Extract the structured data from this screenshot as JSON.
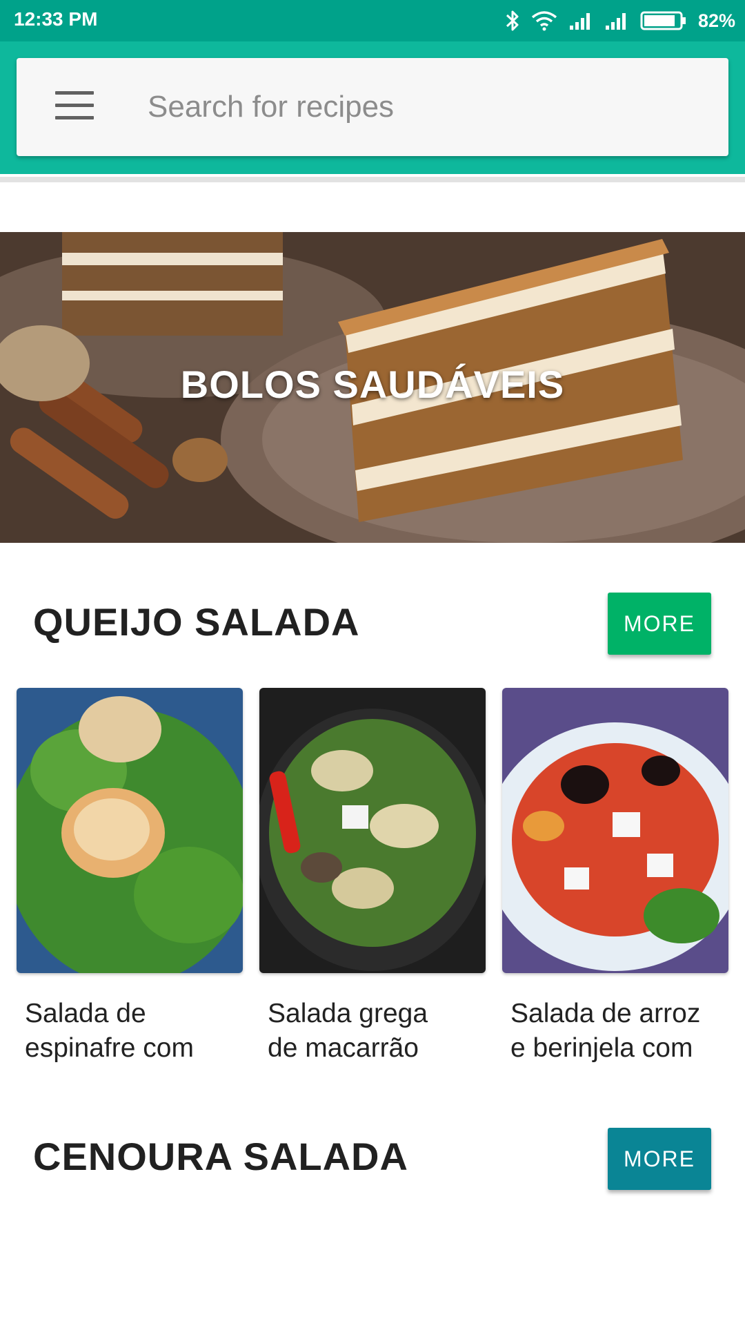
{
  "status_bar": {
    "time": "12:33 PM",
    "battery": "82%"
  },
  "search": {
    "placeholder": "Search for recipes"
  },
  "hero": {
    "title": "BOLOS SAUDÁVEIS"
  },
  "sections": [
    {
      "title": "QUEIJO SALADA",
      "more_label": "MORE",
      "more_color": "#00b267",
      "items": [
        {
          "title_line1": "Salada de",
          "title_line2": "espinafre com"
        },
        {
          "title_line1": "Salada grega",
          "title_line2": "de macarrão"
        },
        {
          "title_line1": "Salada de arroz",
          "title_line2": "e berinjela com"
        }
      ]
    },
    {
      "title": "CENOURA SALADA",
      "more_label": "MORE",
      "more_color": "#0a8595"
    }
  ],
  "colors": {
    "status_bar": "#00a28a",
    "toolbar": "#0eb89c"
  }
}
